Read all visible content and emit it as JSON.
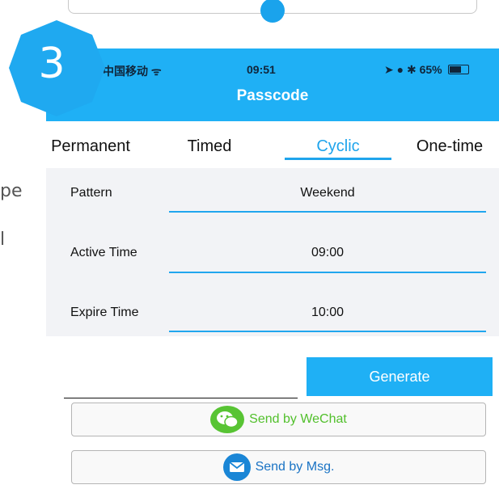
{
  "side_text": [
    "pe",
    "l"
  ],
  "step_badge": {
    "number": "3"
  },
  "status_bar": {
    "carrier": "中国移动 ",
    "wifi": "ᯤ",
    "time": "09:51",
    "right": "➤ ● ✱ 65%"
  },
  "header": {
    "back": "<",
    "title": "Passcode"
  },
  "tabs": [
    {
      "label": "Permanent"
    },
    {
      "label": "Timed"
    },
    {
      "label": "Cyclic",
      "active": true
    },
    {
      "label": "One-time"
    }
  ],
  "form": {
    "rows": [
      {
        "label": "Pattern",
        "value": "Weekend"
      },
      {
        "label": "Active Time",
        "value": "09:00"
      },
      {
        "label": "Expire Time",
        "value": "10:00"
      }
    ]
  },
  "passcode_field": {
    "value": ""
  },
  "generate_button": {
    "label": "Generate"
  },
  "send_buttons": [
    {
      "label": "Send by WeChat",
      "icon": "wechat-icon",
      "color": "#52c02c"
    },
    {
      "label": "Send by Msg.",
      "icon": "message-icon",
      "color": "#1a73c4"
    }
  ],
  "colors": {
    "accent": "#1fb0f5",
    "tab_active": "#1fa4ec",
    "badge": "#1fa9f0"
  }
}
